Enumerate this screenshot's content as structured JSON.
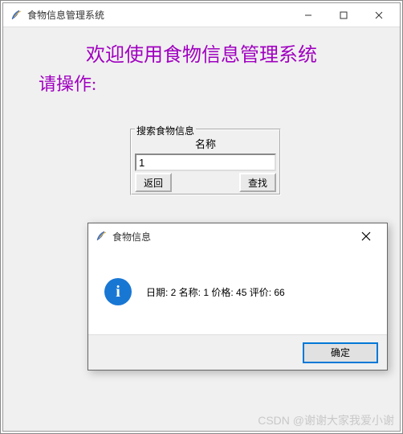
{
  "main_window": {
    "title": "食物信息管理系统",
    "welcome": "欢迎使用食物信息管理系统",
    "prompt": "请操作:"
  },
  "search_frame": {
    "frame_label": "搜索食物信息",
    "name_label": "名称",
    "entry_value": "1",
    "back_label": "返回",
    "search_label": "查找"
  },
  "dialog": {
    "title": "食物信息",
    "message": "日期:  2 名称:  1  价格:  45 评价:  66",
    "ok_label": "确定"
  },
  "watermark": "CSDN @谢谢大家我爱小谢"
}
